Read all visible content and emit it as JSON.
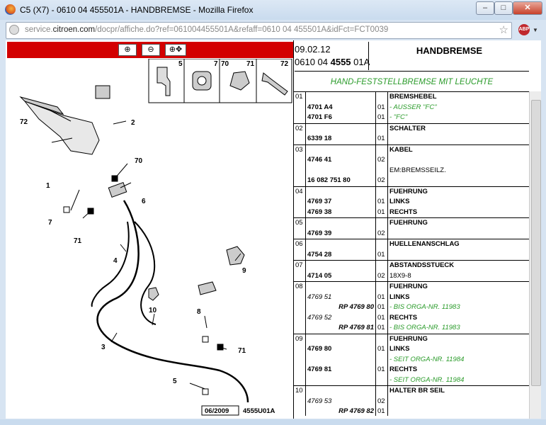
{
  "window": {
    "title": "C5 (X7) - 0610 04 455501A - HANDBREMSE - Mozilla Firefox",
    "min": "–",
    "max": "□",
    "close": "✕"
  },
  "url": {
    "domain_prefix": "service.",
    "domain": "citroen.com",
    "path": "/docpr/affiche.do?ref=061004455501A&refaff=0610 04 455501A&idFct=FCT0039",
    "abp": "ABP"
  },
  "toolbar": {
    "zoom_in": "⊕",
    "zoom_out": "⊖",
    "zoom_move": "⊕✥"
  },
  "header": {
    "date": "09.02.12",
    "ref_a": "0610 04 ",
    "ref_b": "4555",
    "ref_c": " 01A",
    "title": "HANDBREMSE",
    "subtitle": "HAND-FESTSTELLBREMSE MIT LEUCHTE"
  },
  "diagram": {
    "part_boxes": [
      "5",
      "7",
      "70",
      "71",
      "72"
    ],
    "callouts": [
      "72",
      "2",
      "70",
      "1",
      "6",
      "7",
      "71",
      "4",
      "9",
      "10",
      "8",
      "71",
      "3",
      "5"
    ],
    "date": "06/2009",
    "ref": "4555U01A"
  },
  "parts": [
    {
      "num": "01",
      "lines": [
        {
          "pn": "",
          "q": "",
          "text": "BREMSHEBEL",
          "kind": "desc"
        },
        {
          "pn": "4701 A4",
          "q": "01",
          "text": "- AUSSER \"FC\"",
          "kind": "note"
        },
        {
          "pn": "4701 F6",
          "q": "01",
          "text": "- \"FC\"",
          "kind": "note"
        }
      ]
    },
    {
      "num": "02",
      "lines": [
        {
          "pn": "",
          "q": "",
          "text": "SCHALTER",
          "kind": "desc"
        },
        {
          "pn": "6339 18",
          "q": "01",
          "text": "",
          "kind": "desc"
        }
      ]
    },
    {
      "num": "03",
      "lines": [
        {
          "pn": "",
          "q": "",
          "text": "KABEL",
          "kind": "desc"
        },
        {
          "pn": "4746 41",
          "q": "02",
          "text": "",
          "kind": "desc"
        },
        {
          "pn": "",
          "q": "",
          "text": "EM:BREMSSEILZ.",
          "kind": "plain"
        },
        {
          "pn": "16 082 751 80",
          "q": "02",
          "text": "",
          "kind": "desc"
        }
      ]
    },
    {
      "num": "04",
      "lines": [
        {
          "pn": "",
          "q": "",
          "text": "FUEHRUNG",
          "kind": "desc"
        },
        {
          "pn": "4769 37",
          "q": "01",
          "text": "LINKS",
          "kind": "desc"
        },
        {
          "pn": "4769 38",
          "q": "01",
          "text": "RECHTS",
          "kind": "desc"
        }
      ]
    },
    {
      "num": "05",
      "lines": [
        {
          "pn": "",
          "q": "",
          "text": "FUEHRUNG",
          "kind": "desc"
        },
        {
          "pn": "4769 39",
          "q": "02",
          "text": "",
          "kind": "desc"
        }
      ]
    },
    {
      "num": "06",
      "lines": [
        {
          "pn": "",
          "q": "",
          "text": "HUELLENANSCHLAG",
          "kind": "desc"
        },
        {
          "pn": "4754 28",
          "q": "01",
          "text": "",
          "kind": "desc"
        }
      ]
    },
    {
      "num": "07",
      "lines": [
        {
          "pn": "",
          "q": "",
          "text": "ABSTANDSSTUECK",
          "kind": "desc"
        },
        {
          "pn": "4714 05",
          "q": "02",
          "text": "18X9-8",
          "kind": "plain"
        }
      ]
    },
    {
      "num": "08",
      "lines": [
        {
          "pn": "",
          "q": "",
          "text": "FUEHRUNG",
          "kind": "desc"
        },
        {
          "pn": "4769 51",
          "q": "01",
          "text": "LINKS",
          "kind": "desc",
          "italic": true
        },
        {
          "pn": "RP 4769 80",
          "q": "01",
          "text": "- BIS ORGA-NR. 11983",
          "kind": "note",
          "rp": true
        },
        {
          "pn": "4769 52",
          "q": "01",
          "text": "RECHTS",
          "kind": "desc",
          "italic": true
        },
        {
          "pn": "RP 4769 81",
          "q": "01",
          "text": "- BIS ORGA-NR. 11983",
          "kind": "note",
          "rp": true
        }
      ]
    },
    {
      "num": "09",
      "lines": [
        {
          "pn": "",
          "q": "",
          "text": "FUEHRUNG",
          "kind": "desc"
        },
        {
          "pn": "4769 80",
          "q": "01",
          "text": "LINKS",
          "kind": "desc"
        },
        {
          "pn": "",
          "q": "",
          "text": "- SEIT ORGA-NR. 11984",
          "kind": "note"
        },
        {
          "pn": "4769 81",
          "q": "01",
          "text": "RECHTS",
          "kind": "desc"
        },
        {
          "pn": "",
          "q": "",
          "text": "- SEIT ORGA-NR. 11984",
          "kind": "note"
        }
      ]
    },
    {
      "num": "10",
      "lines": [
        {
          "pn": "",
          "q": "",
          "text": "HALTER BR SEIL",
          "kind": "desc"
        },
        {
          "pn": "4769 53",
          "q": "02",
          "text": "",
          "kind": "desc",
          "italic": true
        },
        {
          "pn": "RP 4769 82",
          "q": "01",
          "text": "",
          "kind": "desc",
          "rp": true
        }
      ]
    }
  ]
}
